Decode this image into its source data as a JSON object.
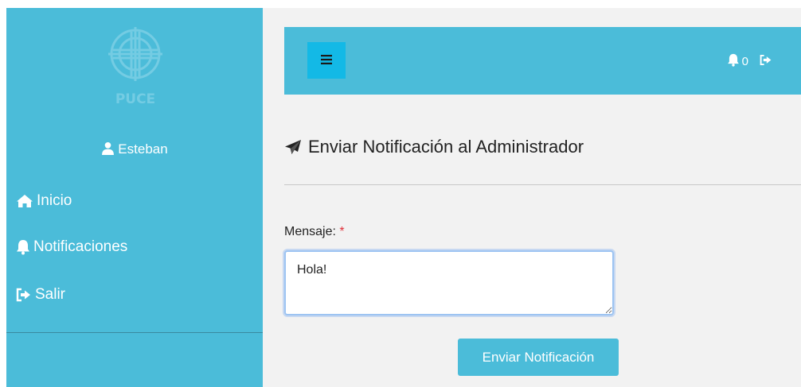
{
  "sidebar": {
    "logo_text": "PUCE",
    "user_name": "Esteban",
    "items": [
      {
        "label": "Inicio",
        "icon": "home-icon"
      },
      {
        "label": "Notificaciones",
        "icon": "bell-icon"
      },
      {
        "label": "Salir",
        "icon": "sign-out-icon"
      }
    ]
  },
  "header": {
    "menu_icon": "hamburger-icon",
    "notification_count": "0",
    "notification_icon": "bell-icon",
    "logout_icon": "sign-out-icon"
  },
  "main": {
    "title": "Enviar Notificación al Administrador",
    "title_icon": "paper-plane-icon",
    "message_label": "Mensaje:",
    "required_mark": "*",
    "message_value": "Hola!",
    "submit_label": "Enviar Notificación"
  },
  "colors": {
    "accent": "#4bbcd9",
    "menu_button": "#13b9e6",
    "required": "#e0303a",
    "background": "#f2f2f2"
  }
}
